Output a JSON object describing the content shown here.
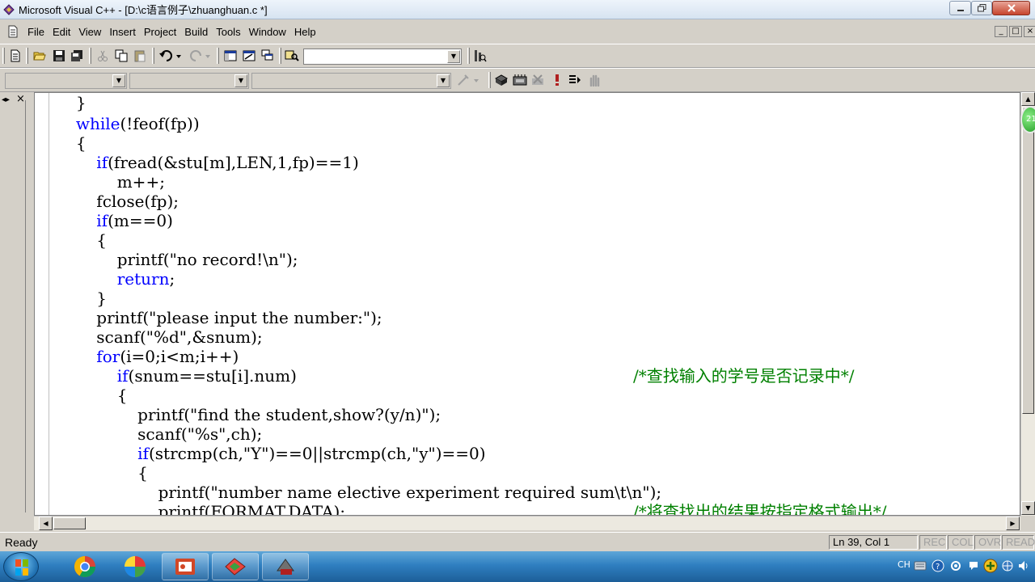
{
  "window": {
    "title": "Microsoft Visual C++ - [D:\\c语言例子\\zhuanghuan.c *]"
  },
  "menu": {
    "items": [
      "File",
      "Edit",
      "View",
      "Insert",
      "Project",
      "Build",
      "Tools",
      "Window",
      "Help"
    ]
  },
  "code": {
    "lines": [
      "        }",
      "        while(!feof(fp))",
      "        {",
      "            if(fread(&stu[m],LEN,1,fp)==1)",
      "                m++;",
      "            fclose(fp);",
      "            if(m==0)",
      "            {",
      "                printf(\"no record!\\n\");",
      "                return;",
      "            }",
      "            printf(\"please input the number:\");",
      "            scanf(\"%d\",&snum);",
      "            for(i=0;i<m;i++)",
      "                if(snum==stu[i].num)",
      "                {",
      "                    printf(\"find the student,show?(y/n)\");",
      "                    scanf(\"%s\",ch);",
      "                    if(strcmp(ch,\"Y\")==0||strcmp(ch,\"y\")==0)",
      "                    {",
      "                        printf(\"number name elective experiment required sum\\t\\n\");",
      "                        printf(FORMAT,DATA);"
    ],
    "comments": {
      "line14": "/*查找输入的学号是否记录中*/",
      "line21": "/*将查找出的结果按指定格式输出*/"
    }
  },
  "status": {
    "ready": "Ready",
    "position": "Ln 39, Col 1",
    "rec": "REC",
    "col": "COL",
    "ovr": "OVR",
    "read": "READ"
  },
  "taskbar": {
    "tray_lang": "CH"
  },
  "badge": {
    "text": "21"
  },
  "colors": {
    "keyword": "#0000ff",
    "comment": "#008000",
    "titlebar": "#d6e3f1",
    "taskbar": "#2f7fc0"
  }
}
